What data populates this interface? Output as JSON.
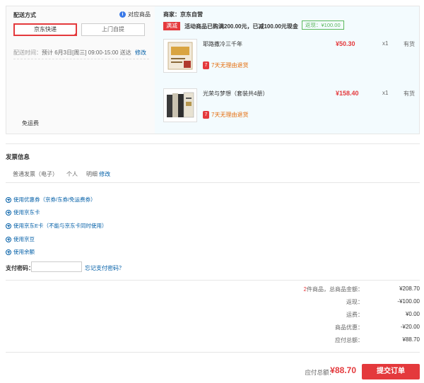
{
  "shipping": {
    "title": "配送方式",
    "info_link": "对应商品",
    "methods": [
      {
        "label": "京东快递",
        "active": true
      },
      {
        "label": "上门自提",
        "active": false
      }
    ],
    "time_label": "配送时间：",
    "time_value": "预计 6月3日[周三] 09:00-15:00 送达",
    "edit": "修改",
    "free_shipping": "免运费"
  },
  "seller": {
    "title": "商家：京东自营",
    "promo_tag": "满减",
    "promo_text": "活动商品已购满200.00元，已减100.00元现金",
    "promo_badge": "返现：¥100.00"
  },
  "items": [
    {
      "name": "耶路撒冷三千年",
      "price": "¥50.30",
      "qty": "x1",
      "stock": "有货",
      "return_policy": "7天无理由退货"
    },
    {
      "name": "光荣与梦想（套装共4册）",
      "price": "¥158.40",
      "qty": "x1",
      "stock": "有货",
      "return_policy": "7天无理由退货"
    }
  ],
  "invoice": {
    "title": "发票信息",
    "type": "普通发票（电子）",
    "holder": "个人",
    "detail": "明细",
    "edit": "修改"
  },
  "coupons": [
    "使用优惠券（京券/东券/免运费券）",
    "使用京东卡",
    "使用京东E卡（不能与京东卡同时使用）",
    "使用京豆",
    "使用余额"
  ],
  "payment_password": {
    "label": "支付密码：",
    "forgot": "忘记支付密码？"
  },
  "summary": {
    "item_count": "2",
    "rows": [
      {
        "label": "件商品，总商品金额：",
        "value": "¥208.70"
      },
      {
        "label": "返现：",
        "value": "-¥100.00"
      },
      {
        "label": "运费：",
        "value": "¥0.00"
      },
      {
        "label": "商品优惠：",
        "value": "-¥20.00"
      },
      {
        "label": "应付总额：",
        "value": "¥88.70"
      }
    ]
  },
  "footer": {
    "total_label": "应付总额：",
    "total_value": "¥88.70",
    "submit": "提交订单"
  },
  "colors": {
    "accent": "#e4393c",
    "link": "#005ea7",
    "promo_green": "#5cb85c",
    "panel_blue": "#f3fbfe"
  }
}
